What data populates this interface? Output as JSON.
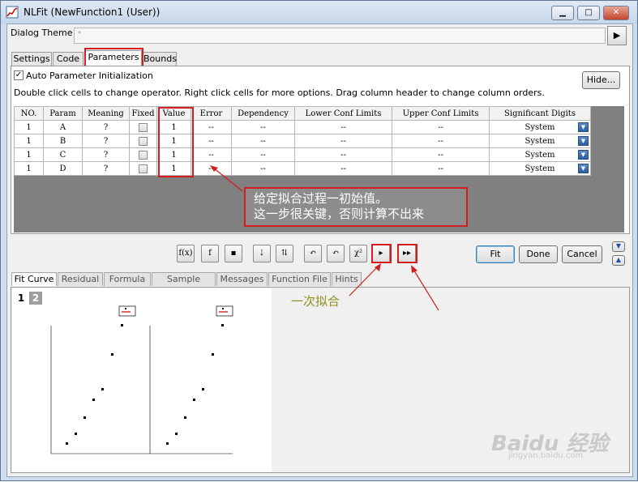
{
  "window": {
    "title": "NLFit (NewFunction1 (User))",
    "controls": [
      "minimize-icon",
      "maximize-icon",
      "close-icon"
    ]
  },
  "dialog_theme": {
    "label": "Dialog Theme",
    "value": "*",
    "arrow": "▶"
  },
  "tabs": [
    "Settings",
    "Code",
    "Parameters",
    "Bounds"
  ],
  "parameters_panel": {
    "auto_init_label": "Auto Parameter Initialization",
    "auto_init_checked": true,
    "hint": "Double click cells to change operator. Right click cells for more options. Drag column header to change column orders.",
    "hide_button": "Hide...",
    "columns": [
      "NO.",
      "Param",
      "Meaning",
      "Fixed",
      "Value",
      "Error",
      "Dependency",
      "Lower Conf Limits",
      "Upper Conf Limits",
      "Significant Digits"
    ],
    "rows": [
      {
        "no": "1",
        "param": "A",
        "meaning": "?",
        "value": "1",
        "error": "--",
        "dependency": "--",
        "lower": "--",
        "upper": "--",
        "digits": "System"
      },
      {
        "no": "1",
        "param": "B",
        "meaning": "?",
        "value": "1",
        "error": "--",
        "dependency": "--",
        "lower": "--",
        "upper": "--",
        "digits": "System"
      },
      {
        "no": "1",
        "param": "C",
        "meaning": "?",
        "value": "1",
        "error": "--",
        "dependency": "--",
        "lower": "--",
        "upper": "--",
        "digits": "System"
      },
      {
        "no": "1",
        "param": "D",
        "meaning": "?",
        "value": "1",
        "error": "--",
        "dependency": "--",
        "lower": "--",
        "upper": "--",
        "digits": "System"
      }
    ]
  },
  "annotation": {
    "line1": "给定拟合过程一初始值。",
    "line2": "这一步很关键，否则计算不出来",
    "note": "一次拟合"
  },
  "toolbar": {
    "icons": [
      "fit-init-icon",
      "function-f-icon",
      "save-disk-icon",
      "sort-down-icon",
      "sort-range-icon",
      "undo-one-icon",
      "undo-all-icon",
      "chi-square-icon",
      "one-iteration-icon",
      "fit-until-converged-icon"
    ],
    "chi_label": "χ²"
  },
  "buttons": {
    "fit": "Fit",
    "done": "Done",
    "cancel": "Cancel"
  },
  "bottom_tabs": [
    "Fit Curve",
    "Residual",
    "Formula",
    "Sample Curve",
    "Messages",
    "Function File",
    "Hints"
  ],
  "pages": [
    "1",
    "2"
  ],
  "watermark": {
    "main": "Baidu 经验",
    "sub": "jingyan.baidu.com"
  }
}
